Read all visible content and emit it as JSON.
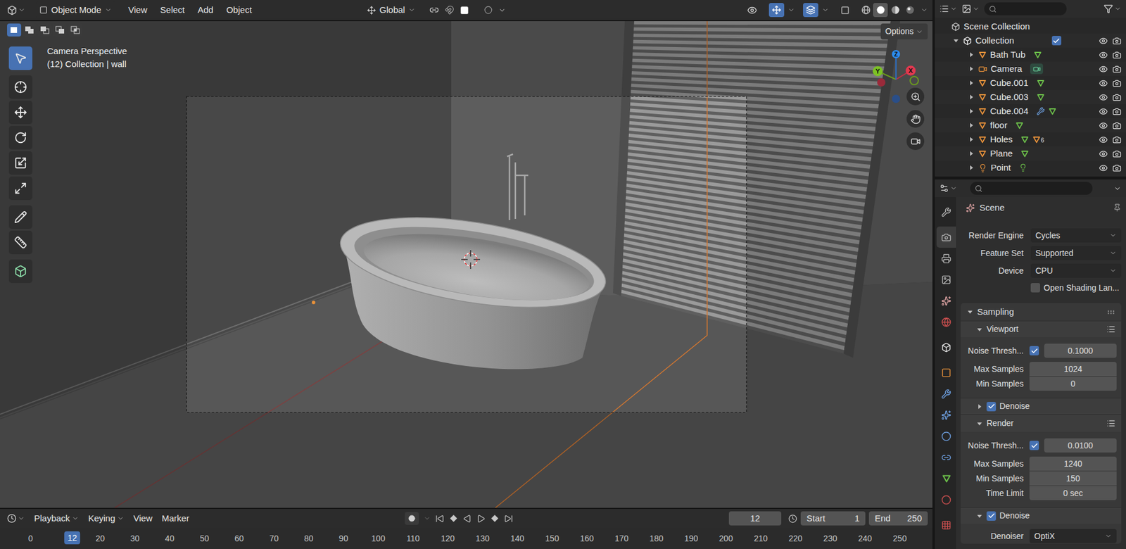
{
  "viewport_header": {
    "mode": "Object Mode",
    "menus": [
      "View",
      "Select",
      "Add",
      "Object"
    ],
    "orientation": "Global",
    "gizmos_on": true,
    "overlays_on": true,
    "xray_on": false,
    "shading": [
      {
        "kind": "wireframe",
        "selected": false
      },
      {
        "kind": "solid",
        "selected": true
      },
      {
        "kind": "material",
        "selected": false
      },
      {
        "kind": "rendered",
        "selected": false
      }
    ]
  },
  "viewport": {
    "view_name": "Camera Perspective",
    "context": "(12) Collection | wall",
    "options": "Options",
    "selection_modes": [
      {
        "kind": "set",
        "selected": true
      },
      {
        "kind": "extend",
        "selected": false
      },
      {
        "kind": "subtract",
        "selected": false
      },
      {
        "kind": "invert",
        "selected": false
      },
      {
        "kind": "intersect",
        "selected": false
      }
    ],
    "tools": [
      {
        "kind": "select",
        "selected": true
      },
      {
        "kind": "cursor",
        "selected": false
      },
      {
        "kind": "move",
        "selected": false
      },
      {
        "kind": "rotate",
        "selected": false
      },
      {
        "kind": "scale",
        "selected": false
      },
      {
        "kind": "transform",
        "selected": false
      },
      {
        "kind": "annotate",
        "selected": false
      },
      {
        "kind": "measure",
        "selected": false
      },
      {
        "kind": "add_cube",
        "selected": false
      }
    ],
    "axes": {
      "x": "X",
      "y": "Y",
      "z": "Z"
    }
  },
  "outliner": {
    "scene_collection": "Scene Collection",
    "collection": {
      "name": "Collection",
      "expanded": true,
      "checked": true,
      "visible": true
    },
    "items": [
      {
        "name": "Bath Tub",
        "kind": "mesh",
        "expanded": false,
        "visible": true,
        "data": [
          "mesh"
        ]
      },
      {
        "name": "Camera",
        "kind": "camera",
        "expanded": false,
        "visible": true,
        "data": [
          "camera_data"
        ]
      },
      {
        "name": "Cube.001",
        "kind": "mesh",
        "expanded": false,
        "visible": true,
        "data": [
          "mesh"
        ]
      },
      {
        "name": "Cube.003",
        "kind": "mesh",
        "expanded": false,
        "visible": true,
        "data": [
          "mesh"
        ]
      },
      {
        "name": "Cube.004",
        "kind": "mesh",
        "expanded": false,
        "visible": true,
        "data": [
          "modifier",
          "mesh"
        ]
      },
      {
        "name": "floor",
        "kind": "mesh",
        "expanded": false,
        "visible": true,
        "data": [
          "mesh"
        ]
      },
      {
        "name": "Holes",
        "kind": "mesh",
        "expanded": false,
        "visible": true,
        "data": [
          "mesh",
          "child_objects"
        ],
        "children_count": "6"
      },
      {
        "name": "Plane",
        "kind": "mesh",
        "expanded": false,
        "visible": true,
        "data": [
          "mesh"
        ]
      },
      {
        "name": "Point",
        "kind": "light",
        "expanded": false,
        "visible": true,
        "data": [
          "light_data"
        ]
      }
    ]
  },
  "properties": {
    "tabs": [
      {
        "kind": "tool",
        "selected": false
      },
      {
        "kind": "render",
        "selected": true
      },
      {
        "kind": "output",
        "selected": false
      },
      {
        "kind": "view_layer",
        "selected": false
      },
      {
        "kind": "scene",
        "selected": false
      },
      {
        "kind": "world",
        "selected": false
      },
      {
        "kind": "collection",
        "selected": false
      },
      {
        "kind": "object",
        "selected": false
      },
      {
        "kind": "modifiers",
        "selected": false
      },
      {
        "kind": "particles",
        "selected": false
      },
      {
        "kind": "physics",
        "selected": false
      },
      {
        "kind": "constraints",
        "selected": false
      },
      {
        "kind": "data",
        "selected": false
      },
      {
        "kind": "material",
        "selected": false
      },
      {
        "kind": "texture",
        "selected": false
      }
    ],
    "context": "Scene",
    "rows": [
      {
        "label": "Render Engine",
        "value": "Cycles"
      },
      {
        "label": "Feature Set",
        "value": "Supported"
      },
      {
        "label": "Device",
        "value": "CPU"
      }
    ],
    "open_shading": {
      "label": "Open Shading Lan...",
      "checked": false
    },
    "sampling": {
      "title": "Sampling",
      "expanded": true,
      "viewport": {
        "title": "Viewport",
        "expanded": true,
        "noise_threshold": {
          "label": "Noise Thresh...",
          "checked": true,
          "value": "0.1000"
        },
        "fields": [
          {
            "label": "Max Samples",
            "value": "1024"
          },
          {
            "label": "Min Samples",
            "value": "0"
          }
        ],
        "denoise": {
          "label": "Denoise",
          "checked": true,
          "expanded": false
        }
      },
      "render": {
        "title": "Render",
        "expanded": true,
        "noise_threshold": {
          "label": "Noise Thresh...",
          "checked": true,
          "value": "0.0100"
        },
        "fields": [
          {
            "label": "Max Samples",
            "value": "1240"
          },
          {
            "label": "Min Samples",
            "value": "150"
          },
          {
            "label": "Time Limit",
            "value": "0 sec"
          }
        ],
        "denoise": {
          "label": "Denoise",
          "checked": true,
          "expanded": true
        },
        "denoiser": {
          "label": "Denoiser",
          "value": "OptiX"
        }
      }
    }
  },
  "timeline": {
    "menus": [
      {
        "label": "Playback",
        "dropdown": true
      },
      {
        "label": "Keying",
        "dropdown": true
      },
      {
        "label": "View",
        "dropdown": false
      },
      {
        "label": "Marker",
        "dropdown": false
      }
    ],
    "current_frame": "12",
    "start_label": "Start",
    "start": "1",
    "end_label": "End",
    "end": "250",
    "ruler": [
      "0",
      "20",
      "30",
      "40",
      "50",
      "60",
      "70",
      "80",
      "90",
      "100",
      "110",
      "120",
      "130",
      "140",
      "150",
      "160",
      "170",
      "180",
      "190",
      "200",
      "210",
      "220",
      "230",
      "240",
      "250"
    ]
  }
}
